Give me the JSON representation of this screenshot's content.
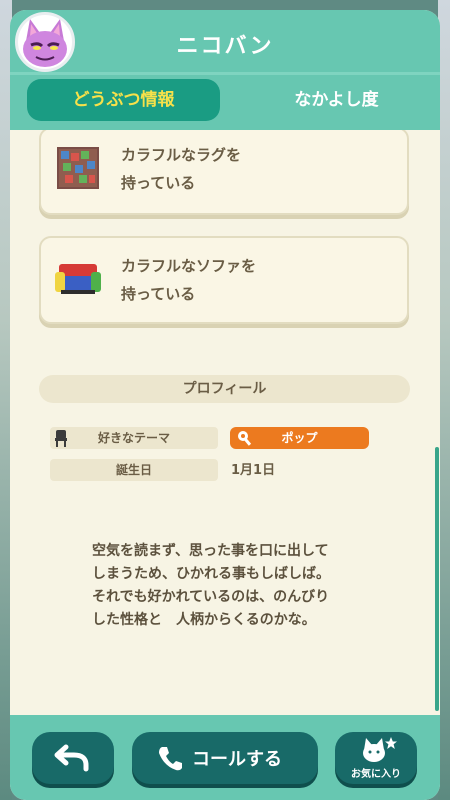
{
  "header": {
    "title": "ニコバン",
    "avatar_icon": "cat-villager-avatar-icon"
  },
  "tabs": [
    {
      "label": "どうぶつ情報",
      "active": true
    },
    {
      "label": "なかよし度",
      "active": false
    }
  ],
  "items": [
    {
      "label": "カラフルなラグを\n持っている",
      "icon": "colorful-rug-icon"
    },
    {
      "label": "カラフルなソファを\n持っている",
      "icon": "colorful-sofa-icon"
    }
  ],
  "profile": {
    "heading": "プロフィール",
    "theme_label": "好きなテーマ",
    "theme_value": "ポップ",
    "birthday_label": "誕生日",
    "birthday_value": "1月1日",
    "description": "空気を読まず、思った事を口に出して\nしまうため、ひかれる事もしばしば。\nそれでも好かれているのは、のんびり\nした性格と　人柄からくるのかな。"
  },
  "footer": {
    "back_icon": "back-arrow-icon",
    "call_label": "コールする",
    "call_icon": "phone-icon",
    "favorite_label": "お気に入り",
    "favorite_icon": "cat-star-icon"
  },
  "colors": {
    "header_bg": "#67c7b1",
    "active_tab": "#1a9c83",
    "active_tab_text": "#f7e14a",
    "button_bg": "#186a68",
    "theme_pill": "#ec7a1f"
  }
}
